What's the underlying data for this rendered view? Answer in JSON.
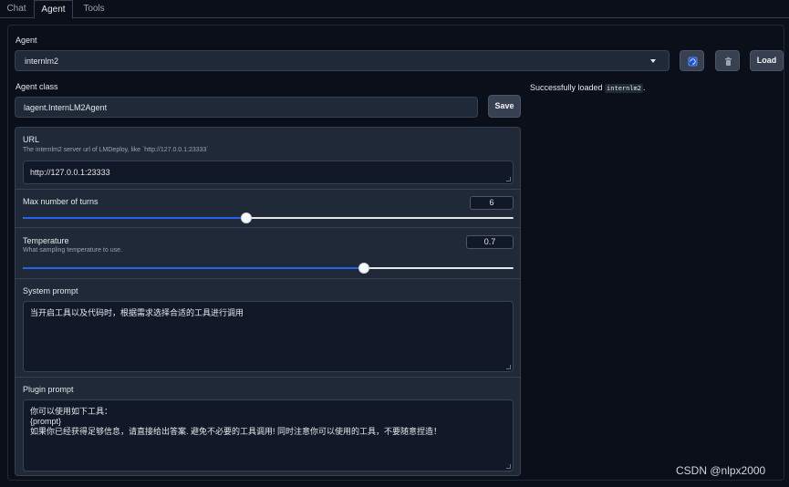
{
  "tabs": [
    {
      "label": "Chat"
    },
    {
      "label": "Agent"
    },
    {
      "label": "Tools"
    }
  ],
  "agent": {
    "label": "Agent",
    "selected": "internlm2",
    "load_label": "Load"
  },
  "agent_class": {
    "label": "Agent class",
    "value": "lagent.InternLM2Agent",
    "save_label": "Save"
  },
  "status": {
    "prefix": "Successfully loaded ",
    "code": "internlm2",
    "suffix": "."
  },
  "url": {
    "label": "URL",
    "hint": "The internlm2 server url of LMDeploy, like `http://127.0.0.1:23333`",
    "value": "http://127.0.0.1:23333"
  },
  "max_turns": {
    "label": "Max number of turns",
    "value": "6",
    "level": 0.455
  },
  "temperature": {
    "label": "Temperature",
    "hint": "What sampling temperature to use.",
    "value": "0.7",
    "level": 0.696
  },
  "system_prompt": {
    "label": "System prompt",
    "value": "当开启工具以及代码时，根据需求选择合适的工具进行调用"
  },
  "plugin_prompt": {
    "label": "Plugin prompt",
    "value": "你可以使用如下工具：\n{prompt}\n如果你已经获得足够信息，请直接给出答案. 避免不必要的工具调用! 同时注意你可以使用的工具，不要随意捏造！"
  },
  "watermark": "CSDN @nlpx2000",
  "colors": {
    "accent": "#2563eb",
    "background": "#0b0f19",
    "surface": "#1f2937"
  }
}
